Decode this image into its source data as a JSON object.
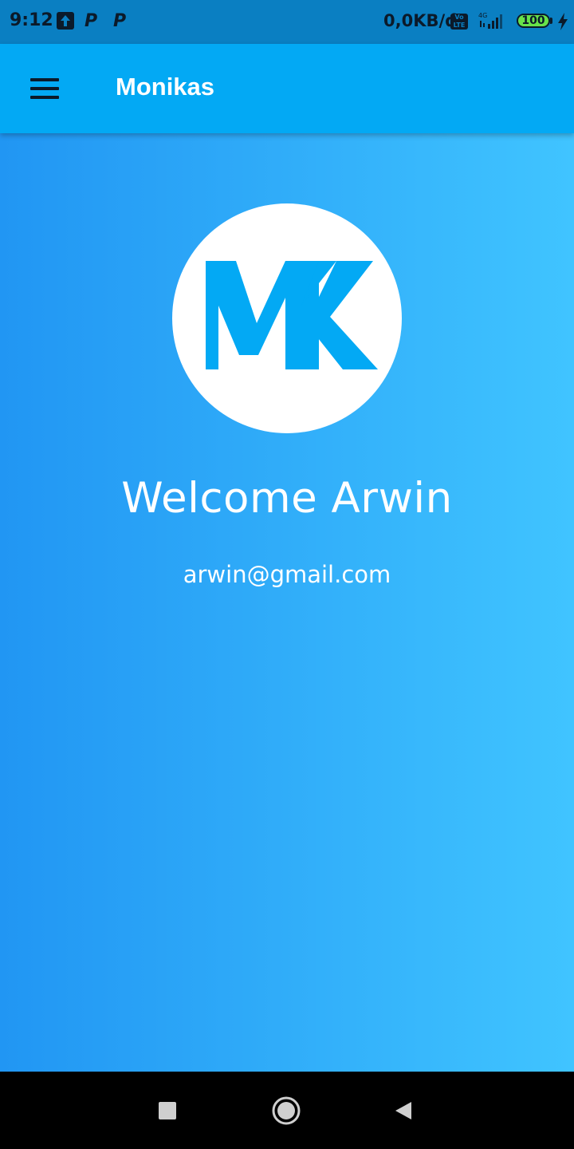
{
  "status_bar": {
    "time": "9:12",
    "notification_icons": [
      "upload-icon",
      "parking-icon",
      "parking-icon"
    ],
    "network_speed": "0,0KB/d",
    "network_type": "4G",
    "volte_label": "Vo LTE",
    "battery_level": "100",
    "background": "#0a7fc2"
  },
  "app_bar": {
    "title": "Monikas",
    "menu_icon": "hamburger-menu-icon",
    "background": "#03a9f4"
  },
  "profile": {
    "logo_text": "MK",
    "logo_color": "#03a9f4",
    "welcome_text": "Welcome Arwin",
    "email": "arwin@gmail.com"
  },
  "background_gradient": {
    "start": "#2196f3",
    "end": "#40c4ff"
  },
  "navigation_bar": {
    "buttons": [
      "recents-icon",
      "home-icon",
      "back-icon"
    ]
  }
}
